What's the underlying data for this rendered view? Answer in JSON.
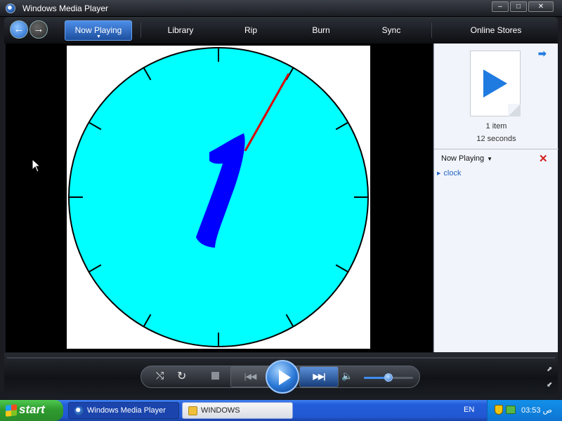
{
  "window": {
    "title": "Windows Media Player",
    "min_glyph": "–",
    "max_glyph": "□",
    "close_glyph": "✕"
  },
  "nav": {
    "back_glyph": "←",
    "forward_glyph": "→",
    "tabs": [
      {
        "label": "Now Playing",
        "active": true
      },
      {
        "label": "Library"
      },
      {
        "label": "Rip"
      },
      {
        "label": "Burn"
      },
      {
        "label": "Sync"
      },
      {
        "label": "Online Stores"
      }
    ]
  },
  "video": {
    "content": "analog clock visualization",
    "face_color": "#00ffff",
    "hand_color": "#0000ff",
    "second_hand_color": "#dd0000"
  },
  "pane": {
    "arrow_glyph": "➡",
    "item_count": "1 item",
    "duration": "12 seconds",
    "now_playing_label": "Now Playing",
    "dropdown_glyph": "▼",
    "clear_glyph": "✕",
    "playlist": [
      {
        "title": "clock"
      }
    ]
  },
  "controls": {
    "shuffle_glyph": "⤭",
    "repeat_glyph": "↻",
    "prev_glyph": "|◀◀",
    "next_glyph": "▶▶|",
    "volume_glyph": "🔈",
    "volume_level": 0.5
  },
  "taskbar": {
    "start_label": "start",
    "tasks": [
      {
        "label": "Windows Media Player"
      },
      {
        "label": "WINDOWS"
      }
    ],
    "language": "EN",
    "clock": "03:53 ص"
  },
  "icons": {
    "app": "wmp-icon",
    "back": "back-arrow-icon",
    "forward": "forward-arrow-icon",
    "file": "media-file-icon",
    "clear": "clear-list-icon",
    "shuffle": "shuffle-icon",
    "repeat": "repeat-icon",
    "volume": "speaker-icon",
    "windows": "windows-flag-icon"
  }
}
